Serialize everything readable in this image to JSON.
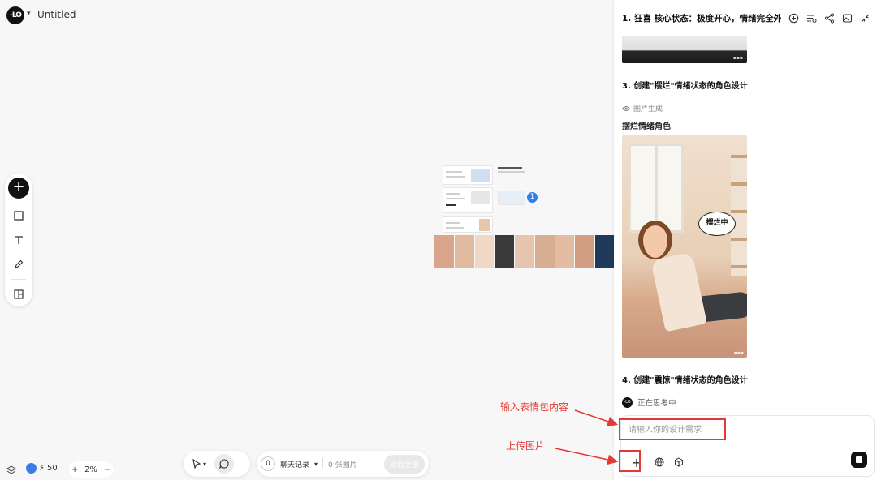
{
  "app": {
    "logo_text": "-LO",
    "doc_title": "Untitled"
  },
  "status": {
    "credits": "50",
    "zoom": "2%"
  },
  "bottom_bar": {
    "count": "0",
    "chat_history": "聊天记录",
    "image_count": "0 张图片",
    "run_all": "运行全部"
  },
  "canvas": {
    "badge": "1"
  },
  "panel": {
    "title": "1. 狂喜 核心状态：极度开心，情绪完全外...",
    "section3_heading": "3. 创建\"摆烂\"情绪状态的角色设计",
    "image_gen_label": "图片生成",
    "card_title": "摆烂情绪角色",
    "bubble_text": "摆烂中",
    "section4_heading": "4. 创建\"震惊\"情绪状态的角色设计",
    "thinking": "正在思考中",
    "input_placeholder": "请输入你的设计需求"
  },
  "annotations": {
    "input_label": "输入表情包内容",
    "upload_label": "上传图片"
  },
  "colors": {
    "annotation": "#e53935",
    "badge": "#2f80ed",
    "accent_dark": "#111111"
  }
}
